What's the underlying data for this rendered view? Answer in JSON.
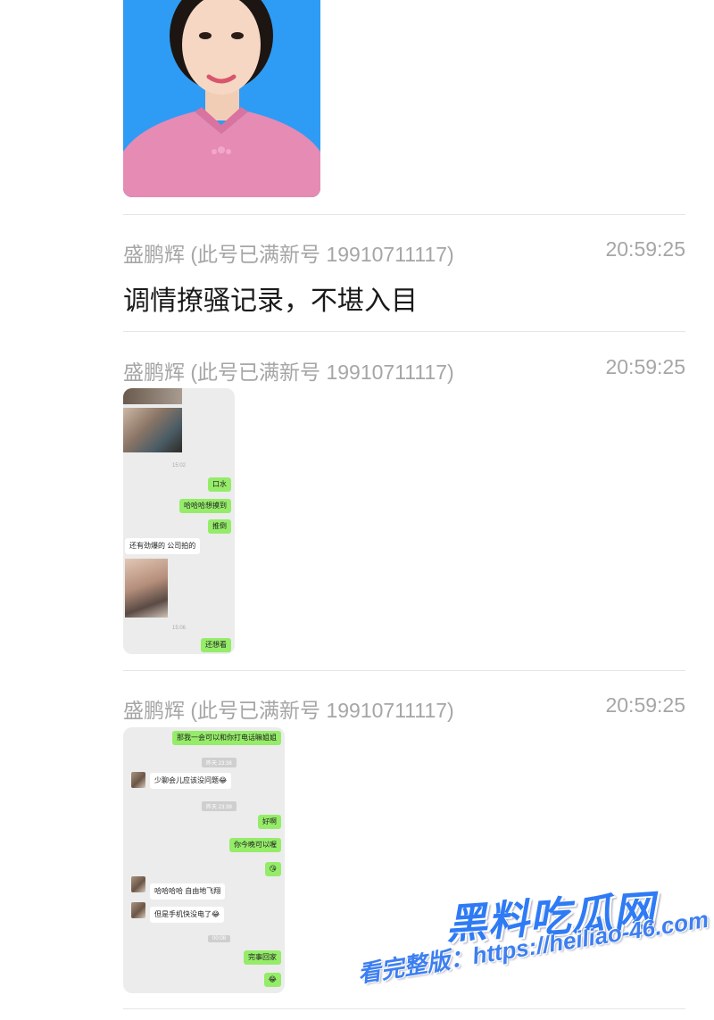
{
  "messages": [
    {
      "sender": "盛鹏辉 (此号已满新号 19910711117)",
      "time": "20:59:25",
      "text": "调情撩骚记录，不堪入目"
    },
    {
      "sender": "盛鹏辉 (此号已满新号 19910711117)",
      "time": "20:59:25",
      "screenshot": {
        "time1": "15:02",
        "bubbles": [
          "口水",
          "哈哈哈想摸到",
          "推倒"
        ],
        "incoming": "还有劲爆的 公司拍的",
        "time2": "15:06",
        "last": "还想看"
      }
    },
    {
      "sender": "盛鹏辉 (此号已满新号 19910711117)",
      "time": "20:59:25",
      "screenshot": {
        "top_bubble": "那我一会可以和你打电话嘛姐姐",
        "ts1": "昨天 23:38",
        "in1": "少聊会儿应该没问题😂",
        "ts2": "昨天 23:39",
        "out1": "好啊",
        "out2": "你今晚可以喔",
        "out3": "😘",
        "in2": "哈哈哈哈 自由地飞翔",
        "in3": "但是手机快没电了😂",
        "ts3": "00:08",
        "out4": "完事回家",
        "out5": "😂"
      }
    }
  ],
  "watermark": {
    "title": "黑料吃瓜网",
    "url": "看完整版：https://heiliao-46.com"
  }
}
